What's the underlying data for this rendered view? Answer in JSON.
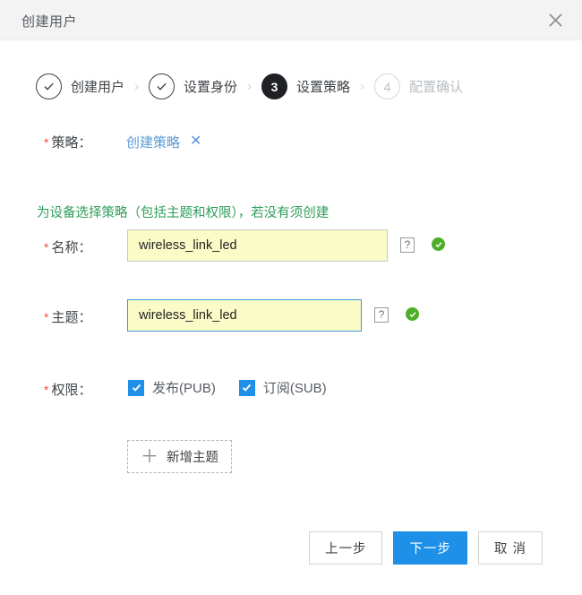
{
  "header": {
    "title": "创建用户",
    "close_icon": "close-icon"
  },
  "steps": [
    {
      "marker": "✓",
      "label": "创建用户",
      "state": "done"
    },
    {
      "marker": "✓",
      "label": "设置身份",
      "state": "done"
    },
    {
      "marker": "3",
      "label": "设置策略",
      "state": "active"
    },
    {
      "marker": "4",
      "label": "配置确认",
      "state": "todo"
    }
  ],
  "step_separator": "›",
  "form": {
    "required_mark": "*",
    "policy": {
      "label": "策略：",
      "link_text": "创建策略",
      "remove_icon_text": "✕"
    },
    "hint": "为设备选择策略（包括主题和权限），若没有须创建",
    "name": {
      "label": "名称：",
      "value": "wireless_link_led",
      "placeholder": "",
      "help_text": "?",
      "valid": true
    },
    "topic": {
      "label": "主题：",
      "value": "wireless_link_led",
      "placeholder": "",
      "help_text": "?",
      "valid": true
    },
    "permission": {
      "label": "权限：",
      "options": [
        {
          "label": "发布(PUB)",
          "checked": true
        },
        {
          "label": "订阅(SUB)",
          "checked": true
        }
      ]
    },
    "add_topic": {
      "icon": "plus-icon",
      "label": "新增主题"
    }
  },
  "footer": {
    "prev_label": "上一步",
    "next_label": "下一步",
    "cancel_label": "取 消"
  },
  "colors": {
    "primary": "#1e90e8",
    "link": "#5b9bd5",
    "hint_green": "#2e9e5b",
    "required_red": "#e8543f",
    "input_bg": "#fbfbc8",
    "header_bg": "#f3f3f4",
    "success": "#4caf27"
  }
}
